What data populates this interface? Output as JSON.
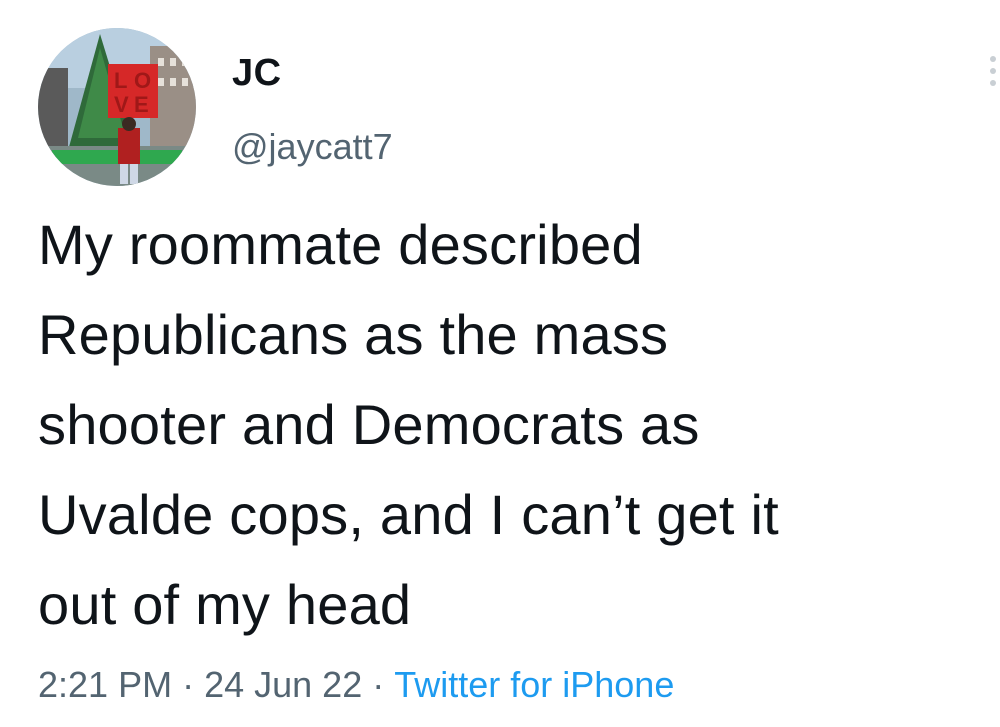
{
  "tweet": {
    "display_name": "JC",
    "handle": "@jaycatt7",
    "text_lines": [
      "My roommate described",
      "Republicans as the mass",
      "shooter and Democrats as",
      "Uvalde cops, and I can’t get it",
      "out of my head"
    ],
    "time": "2:21 PM",
    "date": "24 Jun 22",
    "separator": "·",
    "source": "Twitter for iPhone"
  },
  "icons": {
    "avatar": "profile-photo",
    "more": "more-options-icon"
  },
  "colors": {
    "text": "#0f1419",
    "secondary": "#536471",
    "link": "#1d9bf0"
  }
}
